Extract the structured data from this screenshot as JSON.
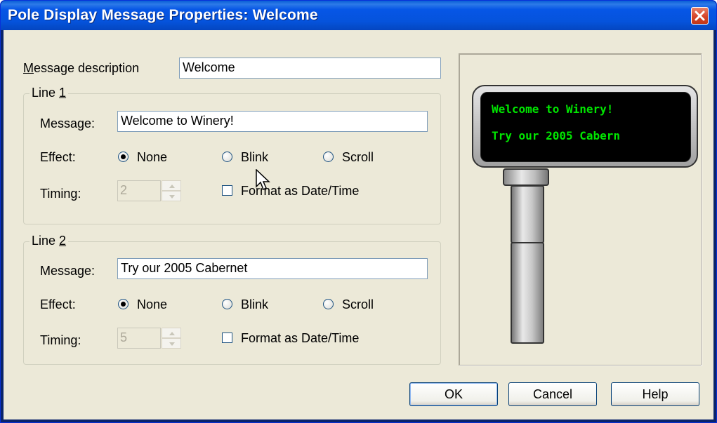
{
  "window": {
    "title": "Pole Display Message Properties: Welcome"
  },
  "description": {
    "label_u": "M",
    "label_rest": "essage description",
    "value": "Welcome"
  },
  "lines": [
    {
      "group_label": "Line ",
      "group_key": "1",
      "message_label": "Message:",
      "message_value": "Welcome to Winery!",
      "effect_label": "Effect:",
      "effects": [
        "None",
        "Blink",
        "Scroll"
      ],
      "selected_effect": "None",
      "timing_label": "Timing:",
      "timing_value": "2",
      "format_label": "Format as Date/Time",
      "format_checked": false
    },
    {
      "group_label": "Line ",
      "group_key": "2",
      "message_label": "Message:",
      "message_value": "Try our 2005 Cabernet",
      "effect_label": "Effect:",
      "effects": [
        "None",
        "Blink",
        "Scroll"
      ],
      "selected_effect": "None",
      "timing_label": "Timing:",
      "timing_value": "5",
      "format_label": "Format as Date/Time",
      "format_checked": false
    }
  ],
  "preview": {
    "line1": "Welcome to Winery!",
    "line2": "Try our 2005 Cabern"
  },
  "buttons": {
    "ok": "OK",
    "cancel": "Cancel",
    "help": "Help"
  },
  "colors": {
    "display_text": "#00e600",
    "title_bar": "#0553dc"
  }
}
